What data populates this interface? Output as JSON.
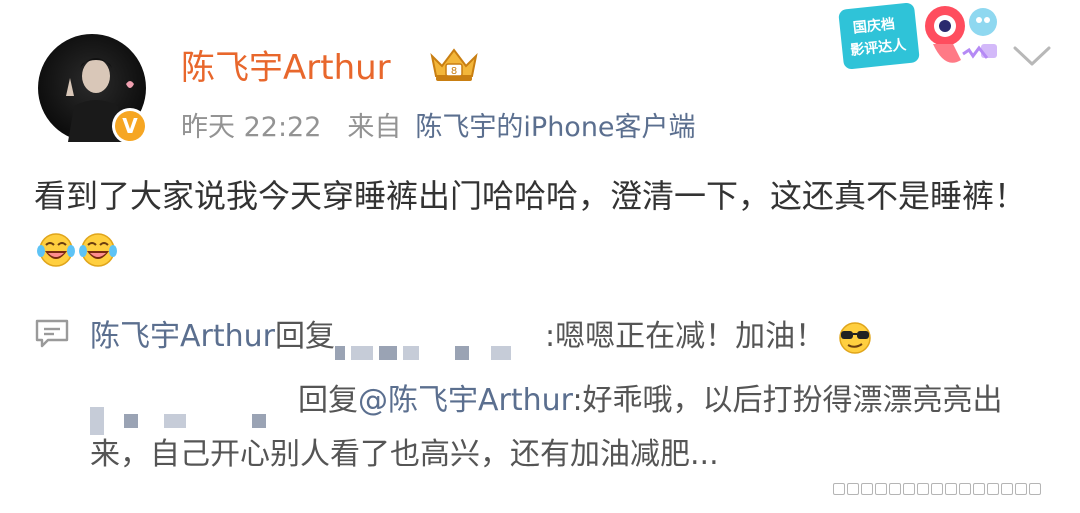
{
  "post": {
    "username": "陈飞宇Arthur",
    "time": "昨天 22:22",
    "source_label": "来自",
    "source_app": "陈飞宇的iPhone客户端",
    "text": "看到了大家说我今天穿睡裤出门哈哈哈，澄清一下，这还真不是睡裤！",
    "emojis": [
      "laughing-tears-emoji",
      "laughing-tears-emoji"
    ]
  },
  "event_badge": {
    "line1": "国庆档",
    "line2": "影评达人"
  },
  "comments": {
    "reply1": {
      "author": "陈飞宇Arthur",
      "action": "回复",
      "text": ":嗯嗯正在减！加油！",
      "emoji": "sunglasses-emoji"
    },
    "reply2": {
      "action": "回复",
      "mention": "@陈飞宇Arthur",
      "text": ":好乖哦，以后打扮得漂漂亮亮出来，自己开心别人看了也高兴，还有加油减肥..."
    }
  },
  "colors": {
    "username": "#e8672c",
    "link": "#5b6f8f",
    "meta": "#939393",
    "verified_badge": "#f6a623"
  }
}
